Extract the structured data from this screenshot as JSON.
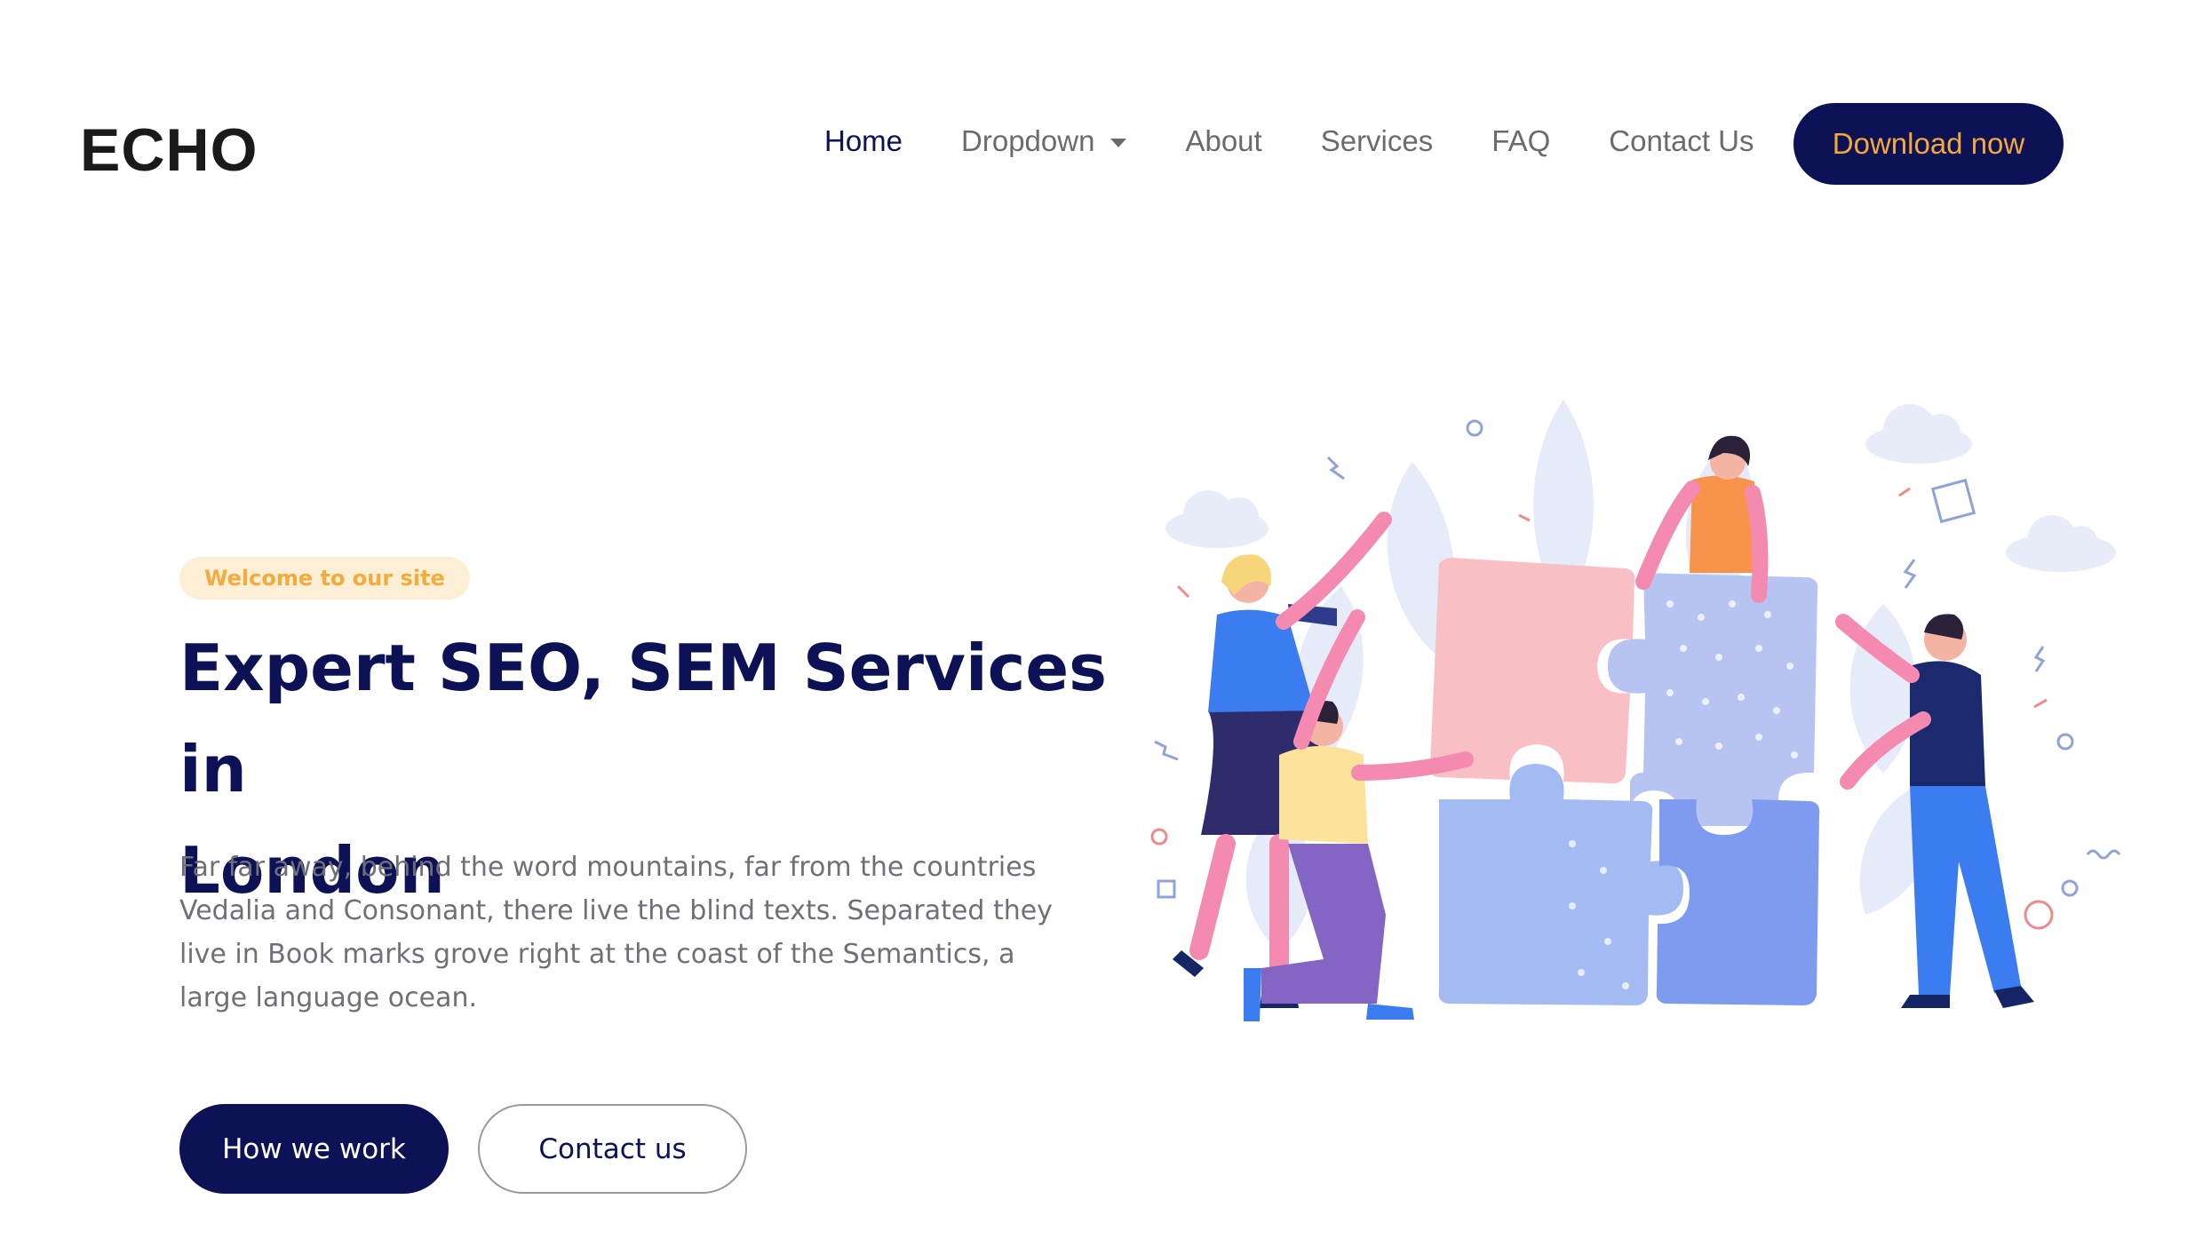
{
  "brand": {
    "logo_text": "ECHO"
  },
  "nav": {
    "items": [
      {
        "label": "Home",
        "active": true
      },
      {
        "label": "Dropdown",
        "has_caret": true
      },
      {
        "label": "About"
      },
      {
        "label": "Services"
      },
      {
        "label": "FAQ"
      },
      {
        "label": "Contact Us"
      }
    ],
    "cta_label": "Download now"
  },
  "hero": {
    "badge": "Welcome to our site",
    "title_line1": "Expert SEO, SEM Services in",
    "title_line2": "London",
    "description": "Far far away, behind the word mountains, far from the countries Vedalia and Consonant, there live the blind texts. Separated they live in Book marks grove right at the coast of the Semantics, a large language ocean.",
    "primary_button": "How we work",
    "secondary_button": "Contact us"
  },
  "colors": {
    "navy": "#0c1255",
    "accent_orange": "#f5a83a",
    "badge_bg": "#fdeed6",
    "text_gray": "#6f6f7a"
  },
  "illustration": {
    "name": "team-assembling-puzzle-illustration"
  }
}
